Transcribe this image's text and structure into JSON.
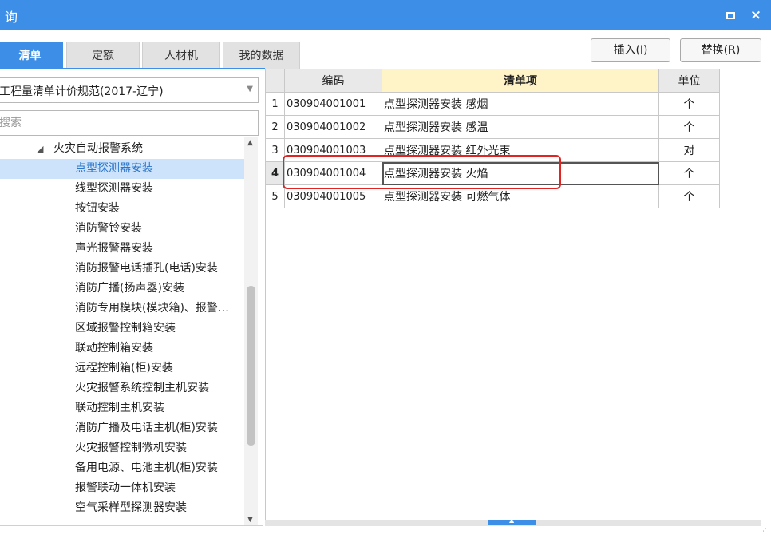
{
  "window": {
    "title": "询",
    "restore_icon": "restore-icon",
    "close_glyph": "×"
  },
  "tabs": [
    {
      "label": "清单",
      "active": true
    },
    {
      "label": "定额",
      "active": false
    },
    {
      "label": "人材机",
      "active": false
    },
    {
      "label": "我的数据",
      "active": false
    }
  ],
  "toolbar": {
    "insert_label": "插入(I)",
    "replace_label": "替换(R)"
  },
  "left": {
    "spec_value": "工程量清单计价规范(2017-辽宁)",
    "search_placeholder": "搜索",
    "tree": {
      "parent": "火灾自动报警系统",
      "children": [
        "点型探测器安装",
        "线型探测器安装",
        "按钮安装",
        "消防警铃安装",
        "声光报警器安装",
        "消防报警电话插孔(电话)安装",
        "消防广播(扬声器)安装",
        "消防专用模块(模块箱)、报警…",
        "区域报警控制箱安装",
        "联动控制箱安装",
        "远程控制箱(柜)安装",
        "火灾报警系统控制主机安装",
        "联动控制主机安装",
        "消防广播及电话主机(柜)安装",
        "火灾报警控制微机安装",
        "备用电源、电池主机(柜)安装",
        "报警联动一体机安装",
        "空气采样型探测器安装"
      ],
      "selected_index": 0
    }
  },
  "grid": {
    "headers": {
      "code": "编码",
      "name": "清单项",
      "unit": "单位"
    },
    "rows": [
      {
        "idx": "1",
        "code": "030904001001",
        "name": "点型探测器安装 感烟",
        "unit": "个"
      },
      {
        "idx": "2",
        "code": "030904001002",
        "name": "点型探测器安装 感温",
        "unit": "个"
      },
      {
        "idx": "3",
        "code": "030904001003",
        "name": "点型探测器安装 红外光束",
        "unit": "对"
      },
      {
        "idx": "4",
        "code": "030904001004",
        "name": "点型探测器安装 火焰",
        "unit": "个"
      },
      {
        "idx": "5",
        "code": "030904001005",
        "name": "点型探测器安装 可燃气体",
        "unit": "个"
      }
    ],
    "current_row": 3
  },
  "colors": {
    "accent": "#3d8ee6",
    "selection_bg": "#cce3fb",
    "highlight_box": "#e02424",
    "header_highlight": "#fff3c8"
  }
}
